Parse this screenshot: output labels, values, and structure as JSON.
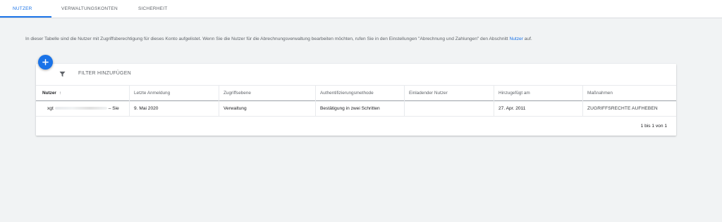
{
  "tabs": [
    {
      "label": "NUTZER",
      "active": true
    },
    {
      "label": "VERWALTUNGSKONTEN",
      "active": false
    },
    {
      "label": "SICHERHEIT",
      "active": false
    }
  ],
  "intro": {
    "text": "In dieser Tabelle sind die Nutzer mit Zugriffsberechtigung für dieses Konto aufgelistet. Wenn Sie die Nutzer für die Abrechnungsverwaltung bearbeiten möchten, rufen Sie in den Einstellungen \"Abrechnung und Zahlungen\" den Abschnitt",
    "link": "Nutzer",
    "suffix": "auf."
  },
  "fab": {
    "icon": "plus-icon",
    "color": "#1a73e8"
  },
  "filter": {
    "label": "FILTER HINZUFÜGEN",
    "icon": "filter-icon"
  },
  "table": {
    "columns": [
      "Nutzer",
      "Letzte Anmeldung",
      "Zugriffsebene",
      "Authentifizierungsmethode",
      "Einladender Nutzer",
      "Hinzugefügt am",
      "Maßnahmen"
    ],
    "sort_icon": "arrow-up-icon",
    "rows": [
      {
        "user_prefix": "xgt",
        "user_suffix": "– Sie",
        "last_login": "9. Mai 2020",
        "access": "Verwaltung",
        "auth": "Bestätigung in zwei Schritten",
        "inviter": "",
        "added": "27. Apr. 2011",
        "action": "ZUGRIFFSRECHTE AUFHEBEN"
      }
    ]
  },
  "pagination": "1 bis 1 von 1",
  "colors": {
    "accent": "#1a73e8",
    "background": "#f1f3f4"
  }
}
